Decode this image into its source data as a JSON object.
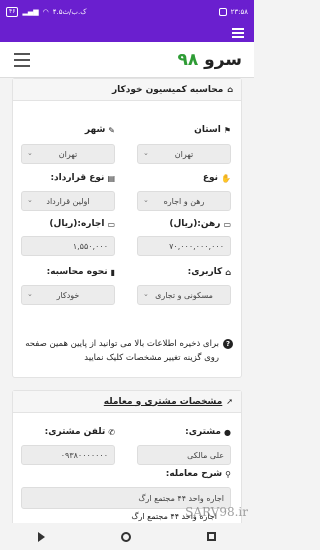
{
  "status": {
    "time": "۲۳:۵۸",
    "speed": "۴.۵ک.ب/ث",
    "battery": "۴۶"
  },
  "app": {
    "name": "سرو",
    "number": "۹۸"
  },
  "section1": {
    "title": "محاسبه کمیسیون خودکار",
    "province": {
      "label": "استان",
      "value": "تهران"
    },
    "city": {
      "label": "شهر",
      "value": "تهران"
    },
    "type": {
      "label": "نوع",
      "value": "رهن و اجاره"
    },
    "contract_type": {
      "label": "نوع قرارداد:",
      "value": "اولین قرارداد"
    },
    "deposit": {
      "label": "رهن:(ریال)",
      "value": "۷۰,۰۰۰,۰۰۰,۰۰۰"
    },
    "rent": {
      "label": "اجاره:(ریال)",
      "value": "۱,۵۵۰,۰۰۰"
    },
    "usage": {
      "label": "کاربری:",
      "value": "مسکونی و تجاری"
    },
    "calc_method": {
      "label": "نحوه محاسبه:",
      "value": "خودکار"
    },
    "note": "برای ذخیره اطلاعات بالا می توانید از پایین همین صفحه روی گزینه تغییر مشخصات کلیک نمایید"
  },
  "section2": {
    "title": "مشخصات مشتری و معامله",
    "customer": {
      "label": "مشتری:",
      "value": "علی مالکی"
    },
    "phone": {
      "label": "تلفن مشتری:",
      "value": "۰۹۳۸۰۰۰۰۰۰۰"
    },
    "description": {
      "label": "شرح معامله:",
      "value": "اجاره واحد ۴۴ مجتمع ارگ"
    },
    "description_overflow": "اجاره واحد ۴۴ مجتمع ارگ"
  },
  "watermark": "SARV98.ir",
  "icons": [
    "menu-icon",
    "house-icon",
    "flag-icon",
    "pin-icon",
    "handshake-icon",
    "file-icon",
    "money-icon",
    "bookmark-icon",
    "info-icon",
    "rocket-icon",
    "user-icon",
    "phone-icon",
    "location-icon"
  ]
}
